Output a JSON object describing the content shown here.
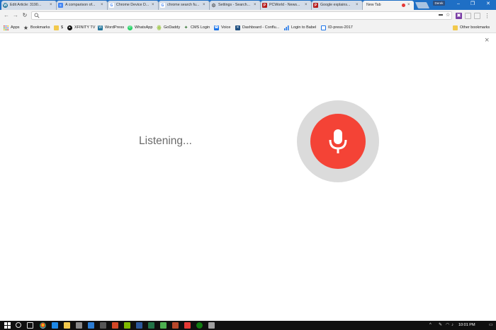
{
  "tabs": [
    {
      "title": "Edit Article: 3190...",
      "favicon": "wordpress-icon",
      "color": "#21759b",
      "active": false
    },
    {
      "title": "A comparison of...",
      "favicon": "docs-icon",
      "color": "#4285f4",
      "active": false
    },
    {
      "title": "Chrome Device D...",
      "favicon": "google-g-icon",
      "color": "#4285f4",
      "active": false
    },
    {
      "title": "chrome search fu...",
      "favicon": "google-g-icon",
      "color": "#4285f4",
      "active": false
    },
    {
      "title": "Settings - Search...",
      "favicon": "gear-icon",
      "color": "#5f6368",
      "active": false
    },
    {
      "title": "PCWorld - News...",
      "favicon": "pcworld-icon",
      "color": "#b71c1c",
      "active": false
    },
    {
      "title": "Google explains...",
      "favicon": "pcworld-icon",
      "color": "#b71c1c",
      "active": false
    },
    {
      "title": "New Tab",
      "favicon": "",
      "color": "",
      "active": true
    }
  ],
  "profile_name": "Derek",
  "omnibox": {
    "value": "",
    "placeholder": ""
  },
  "bookmarks": [
    {
      "label": "Apps",
      "icon": "apps-grid-icon",
      "color": "#e0443e"
    },
    {
      "label": "Bookmarks",
      "icon": "star-icon",
      "color": "#555555"
    },
    {
      "label": "$",
      "icon": "folder-icon",
      "color": "#f2c94c"
    },
    {
      "label": "XFINITY TV",
      "icon": "xfinity-icon",
      "color": "#111111"
    },
    {
      "label": "WordPress",
      "icon": "wordpress-icon",
      "color": "#21759b"
    },
    {
      "label": "WhatsApp",
      "icon": "whatsapp-icon",
      "color": "#25d366"
    },
    {
      "label": "GoDaddy",
      "icon": "godaddy-icon",
      "color": "#7db700"
    },
    {
      "label": "CMS Login",
      "icon": "cms-icon",
      "color": "#3b7a3b"
    },
    {
      "label": "Voice",
      "icon": "voice-icon",
      "color": "#1a73e8"
    },
    {
      "label": "Dashboard - Conflu...",
      "icon": "confluence-icon",
      "color": "#205081"
    },
    {
      "label": "Login to Babel",
      "icon": "chart-icon",
      "color": "#1a73e8"
    },
    {
      "label": "ID-press-2017",
      "icon": "page-icon",
      "color": "#1a73e8"
    },
    {
      "label": "Other bookmarks",
      "icon": "folder-icon",
      "color": "#f2c94c"
    }
  ],
  "voice": {
    "status_text": "Listening...",
    "mic_color": "#f44336",
    "ring_color": "#dbdbdb"
  },
  "taskbar": {
    "time": "10:01 PM"
  }
}
